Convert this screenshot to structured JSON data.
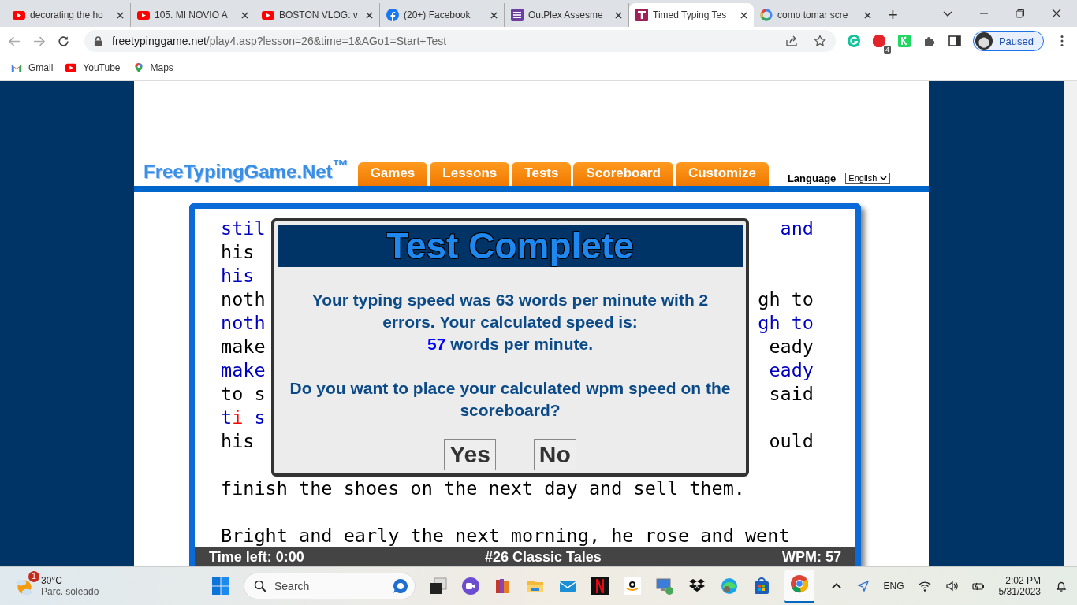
{
  "browser": {
    "tabs": [
      {
        "title": "decorating the ho",
        "kind": "video",
        "selected": false
      },
      {
        "title": "105. MI NOVIO A",
        "kind": "video",
        "selected": false
      },
      {
        "title": "BOSTON VLOG: v",
        "kind": "video",
        "selected": false
      },
      {
        "title": "(20+) Facebook",
        "kind": "social",
        "selected": false
      },
      {
        "title": "OutPlex Assesme",
        "kind": "form",
        "selected": false
      },
      {
        "title": "Timed Typing Tes",
        "kind": "typing",
        "selected": true
      },
      {
        "title": "como tomar scre",
        "kind": "search",
        "selected": false
      }
    ],
    "new_tab": "+",
    "address": {
      "host": "freetypinggame.net",
      "path": "/play4.asp?lesson=26&time=1&AGo1=Start+Test"
    },
    "extension_badge": "4",
    "profile": "Paused",
    "bookmarks": [
      {
        "label": "Gmail",
        "kind": "mail"
      },
      {
        "label": "YouTube",
        "kind": "video"
      },
      {
        "label": "Maps",
        "kind": "map"
      }
    ]
  },
  "site": {
    "logo": "FreeTypingGame.Net$^{™}$",
    "nav": [
      "Games",
      "Lessons",
      "Tests",
      "Scoreboard",
      "Customize"
    ],
    "language_label": "Language",
    "language_value": "English"
  },
  "lines": [
    {
      "kind": "typed",
      "left": [
        {
          "text": "stil",
          "error": false
        }
      ],
      "right": "and"
    },
    {
      "kind": "source",
      "left": [
        {
          "text": "his",
          "error": false
        }
      ]
    },
    {
      "kind": "typed",
      "left": [
        {
          "text": "his",
          "error": false
        }
      ]
    },
    {
      "kind": "source",
      "left": [
        {
          "text": "noth",
          "error": false
        }
      ],
      "right": "gh to"
    },
    {
      "kind": "typed",
      "left": [
        {
          "text": "noth",
          "error": false
        }
      ],
      "right": "gh to"
    },
    {
      "kind": "source",
      "left": [
        {
          "text": "make",
          "error": false
        }
      ],
      "right": "eady"
    },
    {
      "kind": "typed",
      "left": [
        {
          "text": "make",
          "error": false
        }
      ],
      "right": "eady"
    },
    {
      "kind": "source",
      "left": [
        {
          "text": "to s",
          "error": false
        }
      ],
      "right": "said"
    },
    {
      "kind": "typed",
      "left": [
        {
          "text": "t",
          "error": false
        },
        {
          "text": "i",
          "error": true
        },
        {
          "text": " s",
          "error": false
        }
      ]
    },
    {
      "kind": "source",
      "left": [
        {
          "text": "his",
          "error": false
        }
      ],
      "right": "ould"
    },
    {
      "kind": "blank"
    },
    {
      "kind": "source",
      "left": [
        {
          "text": "finish the shoes on the next day and sell them.",
          "error": false
        }
      ]
    },
    {
      "kind": "blank"
    },
    {
      "kind": "source",
      "left": [
        {
          "text": "Bright and early the next morning, he rose and went",
          "error": false
        }
      ]
    }
  ],
  "dialog": {
    "title": "Test Complete",
    "message": "Your typing speed was 63 words per minute with 2 errors. Your calculated speed is:",
    "speed_value": "57",
    "speed_suffix": "words per minute.",
    "question": "Do you want to place your calculated wpm speed on the scoreboard?",
    "buttons": [
      "Yes",
      "No"
    ]
  },
  "status_bar": {
    "time_left": "Time left: 0:00",
    "lesson": "#26 Classic Tales",
    "wpm": "WPM: 57"
  },
  "taskbar": {
    "weather_badge": "1",
    "temperature": "30°C",
    "condition": "Parc. soleado",
    "search": "Search",
    "language": "ENG",
    "time": "2:02 PM",
    "date": "5/31/2023"
  }
}
